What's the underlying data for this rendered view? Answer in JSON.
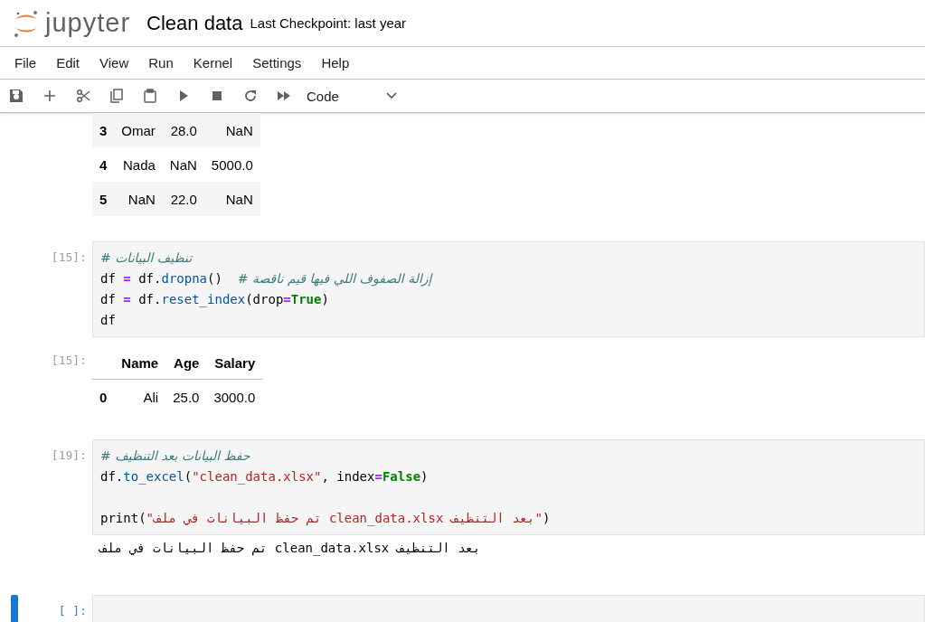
{
  "header": {
    "logo_text": "jupyter",
    "title": "Clean data",
    "checkpoint": "Last Checkpoint: last year"
  },
  "menu": [
    "File",
    "Edit",
    "View",
    "Run",
    "Kernel",
    "Settings",
    "Help"
  ],
  "toolbar": {
    "cell_type": "Code"
  },
  "cells": [
    {
      "kind": "table_output",
      "selected": false,
      "table": {
        "rows": [
          {
            "index": "3",
            "cells": [
              "Omar",
              "28.0",
              "NaN"
            ]
          },
          {
            "index": "4",
            "cells": [
              "Nada",
              "NaN",
              "5000.0"
            ]
          },
          {
            "index": "5",
            "cells": [
              "NaN",
              "22.0",
              "NaN"
            ]
          }
        ]
      }
    },
    {
      "kind": "code",
      "selected": false,
      "prompt": "[15]:",
      "lines": [
        {
          "tokens": [
            {
              "kind": "comment",
              "text": "# تنظيف البيانات"
            }
          ]
        },
        {
          "tokens": [
            {
              "kind": "plain",
              "text": "df "
            },
            {
              "kind": "op",
              "text": "="
            },
            {
              "kind": "plain",
              "text": " df."
            },
            {
              "kind": "func",
              "text": "dropna"
            },
            {
              "kind": "plain",
              "text": "()  "
            },
            {
              "kind": "comment",
              "text": "# إزالة الصفوف اللي فيها قيم ناقصة"
            }
          ]
        },
        {
          "tokens": [
            {
              "kind": "plain",
              "text": "df "
            },
            {
              "kind": "op",
              "text": "="
            },
            {
              "kind": "plain",
              "text": " df."
            },
            {
              "kind": "func",
              "text": "reset_index"
            },
            {
              "kind": "plain",
              "text": "(drop"
            },
            {
              "kind": "op",
              "text": "="
            },
            {
              "kind": "kw",
              "text": "True"
            },
            {
              "kind": "plain",
              "text": ")"
            }
          ]
        },
        {
          "tokens": [
            {
              "kind": "plain",
              "text": "df"
            }
          ]
        }
      ]
    },
    {
      "kind": "table_output",
      "selected": false,
      "prompt": "[15]:",
      "table": {
        "columns": [
          "Name",
          "Age",
          "Salary"
        ],
        "rows": [
          {
            "index": "0",
            "cells": [
              "Ali",
              "25.0",
              "3000.0"
            ]
          }
        ]
      }
    },
    {
      "kind": "code",
      "selected": false,
      "prompt": "[19]:",
      "lines": [
        {
          "tokens": [
            {
              "kind": "comment",
              "text": "# حفظ البيانات بعد التنظيف"
            }
          ]
        },
        {
          "tokens": [
            {
              "kind": "plain",
              "text": "df."
            },
            {
              "kind": "func",
              "text": "to_excel"
            },
            {
              "kind": "plain",
              "text": "("
            },
            {
              "kind": "string",
              "text": "\"clean_data.xlsx\""
            },
            {
              "kind": "plain",
              "text": ", index"
            },
            {
              "kind": "op",
              "text": "="
            },
            {
              "kind": "kw",
              "text": "False"
            },
            {
              "kind": "plain",
              "text": ")"
            }
          ]
        },
        {
          "kind": "blank"
        },
        {
          "tokens": [
            {
              "kind": "plain",
              "text": "print("
            },
            {
              "kind": "string",
              "text": "\"تم حفظ البيانات في ملف clean_data.xlsx بعد التنظيف\""
            },
            {
              "kind": "plain",
              "text": ")"
            }
          ]
        }
      ]
    },
    {
      "kind": "stream_output",
      "selected": false,
      "text": "تم حفظ البيانات في ملف clean_data.xlsx بعد التنظيف"
    },
    {
      "kind": "code",
      "selected": true,
      "prompt": "[ ]:"
    }
  ]
}
